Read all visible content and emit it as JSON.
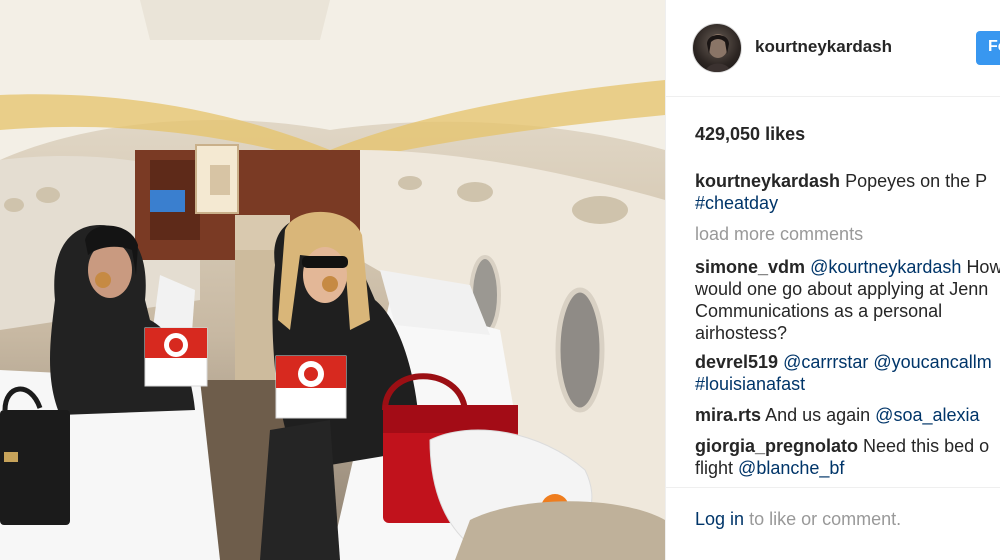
{
  "post": {
    "username": "kourtneykardash",
    "follow_label": "Fo",
    "likes": "429,050 likes"
  },
  "caption": {
    "author": "kourtneykardash",
    "text": "Popeyes on the P",
    "hashtag": "#cheatday"
  },
  "load_more_label": "load more comments",
  "comments": [
    {
      "author": "simone_vdm",
      "mention": "@kourtneykardash",
      "text_line1": "How",
      "text_line2": "would one go about applying at Jenn",
      "text_line3": "Communications as a personal",
      "text_line4": "airhostess?"
    },
    {
      "author": "devrel519",
      "mention1": "@carrrstar",
      "mention2": "@youcancallm",
      "hashtag": "#louisianafast"
    },
    {
      "author": "mira.rts",
      "text": "And us again",
      "mention": "@soa_alexia"
    },
    {
      "author": "giorgia_pregnolato",
      "text": "Need this bed o",
      "text_line2": "flight",
      "mention": "@blanche_bf"
    }
  ],
  "footer": {
    "login_label": "Log in",
    "login_suffix": "to like or comment."
  },
  "colors": {
    "follow_blue": "#3897f0",
    "link_navy": "#003569",
    "muted_gray": "#999999",
    "text_dark": "#262626"
  },
  "icons": {
    "avatar": "profile-photo"
  }
}
